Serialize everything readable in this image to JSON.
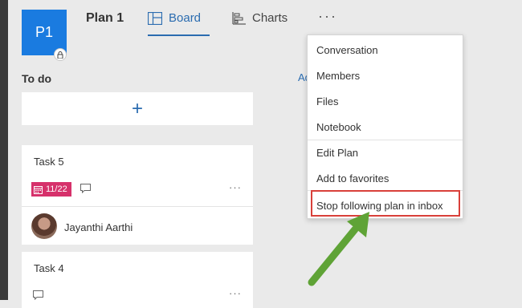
{
  "header": {
    "plan_initials": "P1",
    "plan_title": "Plan 1",
    "tabs": [
      {
        "label": "Board",
        "icon": "board-icon",
        "active": true
      },
      {
        "label": "Charts",
        "icon": "charts-icon",
        "active": false
      }
    ],
    "more_label": "···"
  },
  "board": {
    "bucket_title": "To do",
    "add_task_label": "+",
    "add_bucket_label": "Ad",
    "cards": [
      {
        "title": "Task 5",
        "due": "11/22",
        "assignee": "Jayanthi Aarthi",
        "more": "···"
      },
      {
        "title": "Task 4",
        "more": "···"
      }
    ]
  },
  "menu": {
    "items": [
      "Conversation",
      "Members",
      "Files",
      "Notebook",
      "Edit Plan",
      "Add to favorites",
      "Stop following plan in inbox"
    ],
    "highlighted": "Stop following plan in inbox"
  },
  "colors": {
    "accent": "#2b6cb0",
    "plan_tile": "#1a7be0",
    "due_badge": "#d6316b",
    "highlight_box": "#d9403a",
    "arrow": "#5fa336"
  }
}
